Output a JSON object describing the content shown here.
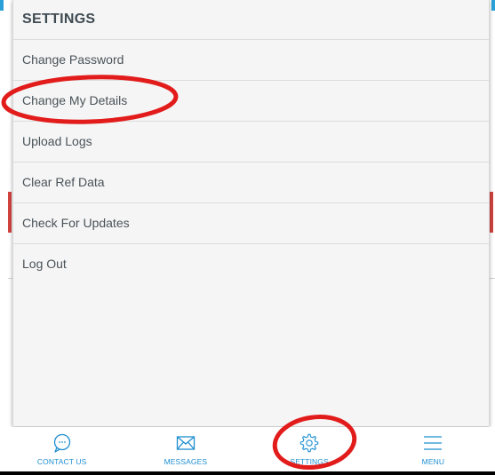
{
  "settings_panel": {
    "title": "SETTINGS",
    "items": [
      {
        "label": "Change Password"
      },
      {
        "label": "Change My Details"
      },
      {
        "label": "Upload Logs"
      },
      {
        "label": "Clear Ref Data"
      },
      {
        "label": "Check For Updates"
      },
      {
        "label": "Log Out"
      }
    ]
  },
  "tabbar": {
    "tabs": [
      {
        "label": "CONTACT US",
        "icon": "chat-bubble-icon"
      },
      {
        "label": "MESSAGES",
        "icon": "envelope-icon"
      },
      {
        "label": "SETTINGS",
        "icon": "gear-icon"
      },
      {
        "label": "MENU",
        "icon": "hamburger-icon"
      }
    ]
  },
  "colors": {
    "accent": "#1f8fd1",
    "annotation": "#e21b1b",
    "panel_bg": "#f5f5f5",
    "text": "#4a5359"
  }
}
